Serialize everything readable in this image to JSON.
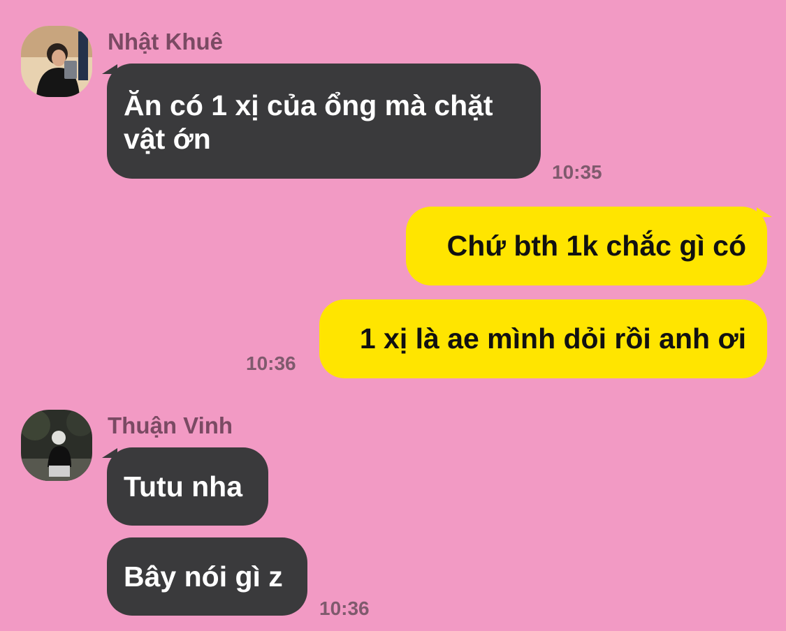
{
  "messages": [
    {
      "sender": "Nhật Khuê",
      "avatar_icon": "user-avatar-photo",
      "lines": [
        "Ăn có 1 xị của ổng mà chặt",
        "vật ớn"
      ],
      "time": "10:35"
    },
    {
      "outgoing": [
        {
          "text": "Chứ bth 1k chắc gì có"
        },
        {
          "text": "1 xị là ae mình dỏi rồi anh ơi"
        }
      ],
      "time": "10:36"
    },
    {
      "sender": "Thuận Vinh",
      "avatar_icon": "user-avatar-photo",
      "incoming": [
        {
          "text": "Tutu nha"
        },
        {
          "text": "Bây nói gì z"
        }
      ],
      "time": "10:36"
    }
  ],
  "colors": {
    "background": "#f29ac4",
    "incoming_bubble": "#3a3a3c",
    "outgoing_bubble": "#ffe500",
    "name_text": "#7a4a63",
    "time_text": "#7f5a6d"
  }
}
